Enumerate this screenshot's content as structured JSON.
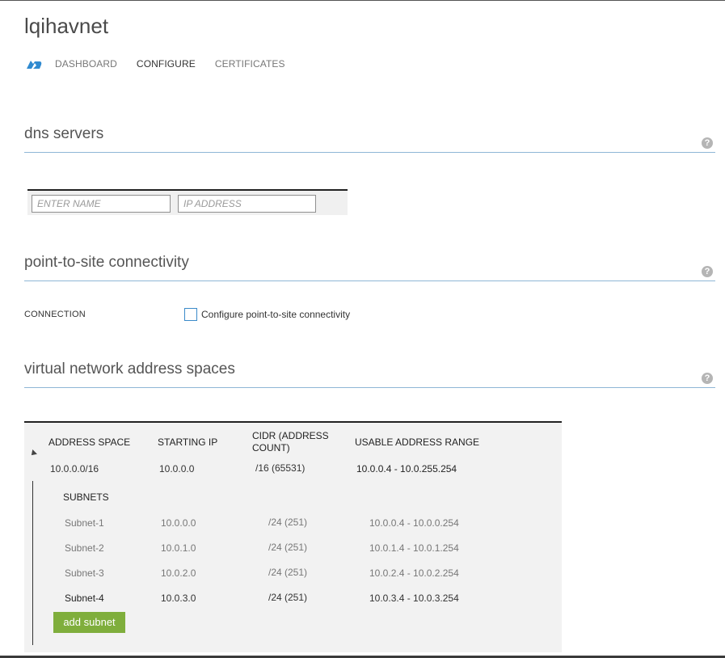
{
  "header": {
    "title": "lqihavnet",
    "tabs": [
      "DASHBOARD",
      "CONFIGURE",
      "CERTIFICATES"
    ],
    "active_tab": "CONFIGURE",
    "icon": "cloud-network-icon"
  },
  "dns": {
    "title": "dns servers",
    "name_placeholder": "ENTER NAME",
    "ip_placeholder": "IP ADDRESS"
  },
  "p2s": {
    "title": "point-to-site connectivity",
    "connection_label": "CONNECTION",
    "checkbox_label": "Configure point-to-site connectivity",
    "checked": false
  },
  "address_spaces": {
    "title": "virtual network address spaces",
    "headers": {
      "address_space": "ADDRESS SPACE",
      "starting_ip": "STARTING IP",
      "cidr_line1": "CIDR (ADDRESS",
      "cidr_line2": "COUNT)",
      "usable_range": "USABLE ADDRESS RANGE"
    },
    "space": {
      "address_space": "10.0.0.0/16",
      "starting_ip": "10.0.0.0",
      "cidr": "/16 (65531)",
      "usable_range": "10.0.0.4 - 10.0.255.254"
    },
    "subnets_label": "SUBNETS",
    "subnets": [
      {
        "name": "Subnet-1",
        "starting_ip": "10.0.0.0",
        "cidr": "/24 (251)",
        "range": "10.0.0.4 - 10.0.0.254"
      },
      {
        "name": "Subnet-2",
        "starting_ip": "10.0.1.0",
        "cidr": "/24 (251)",
        "range": "10.0.1.4 - 10.0.1.254"
      },
      {
        "name": "Subnet-3",
        "starting_ip": "10.0.2.0",
        "cidr": "/24 (251)",
        "range": "10.0.2.4 - 10.0.2.254"
      },
      {
        "name": "Subnet-4",
        "starting_ip": "10.0.3.0",
        "cidr": "/24 (251)",
        "range": "10.0.3.4 - 10.0.3.254"
      }
    ],
    "add_subnet_label": "add subnet"
  },
  "help_glyph": "?",
  "colors": {
    "accent_line": "#8fb6d6",
    "checkbox_border": "#3b8ac9",
    "add_button": "#7fae3c",
    "icon_blue": "#2f8ad0"
  }
}
